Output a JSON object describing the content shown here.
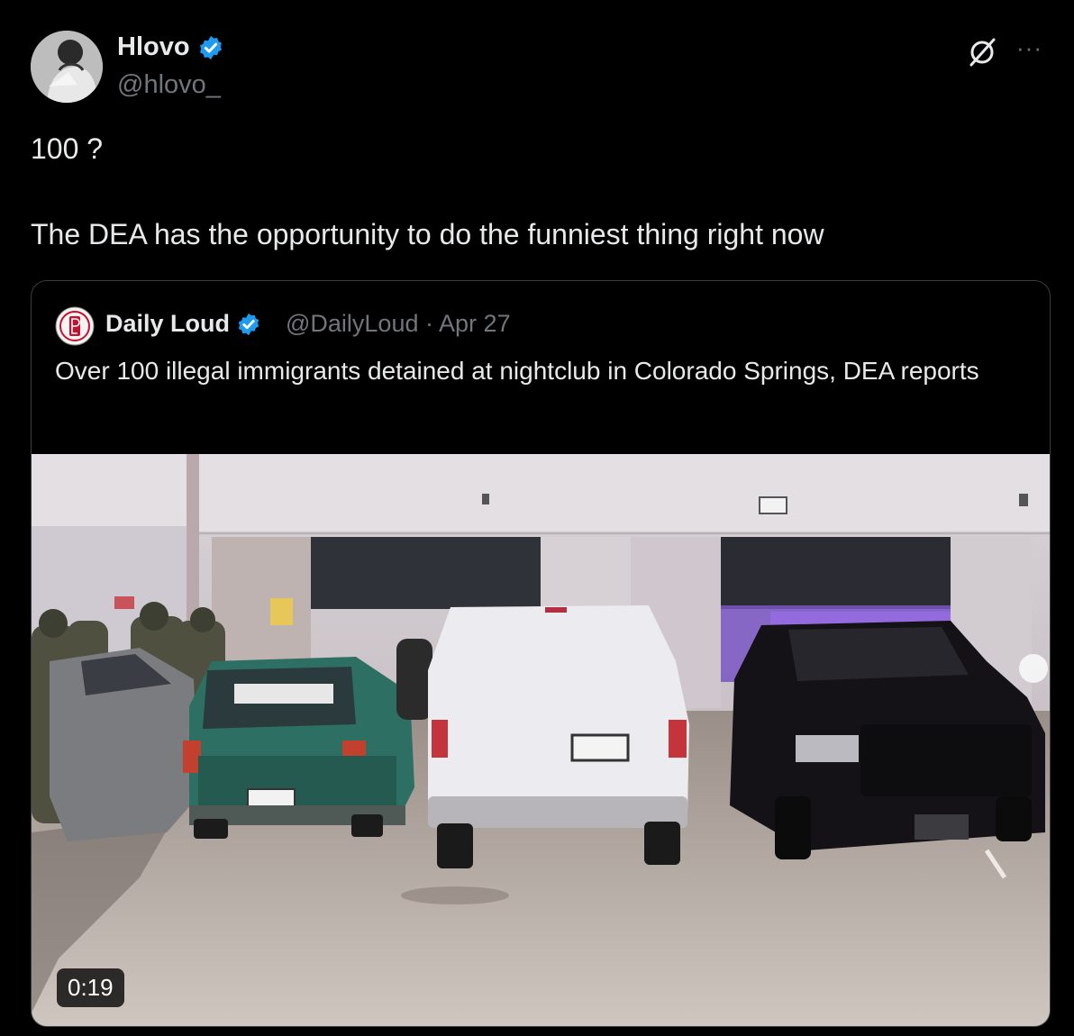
{
  "author": {
    "display_name": "Hlovo",
    "handle": "@hlovo_",
    "verified": true
  },
  "tweet": {
    "lines": [
      "100 ?",
      "The DEA has the opportunity to do the funniest thing right now"
    ]
  },
  "icons": {
    "grok": "grok-icon",
    "more": "more-icon",
    "verified": "verified-badge-icon"
  },
  "quote": {
    "display_name": "Daily Loud",
    "handle": "@DailyLoud",
    "separator": "·",
    "date": "Apr 27",
    "text": "Over 100 illegal immigrants detained at nightclub in Colorado Springs, DEA reports",
    "media": {
      "kind": "video",
      "duration": "0:19"
    }
  },
  "colors": {
    "background": "#000000",
    "text": "#e7e9ea",
    "secondary": "#71767b",
    "verified": "#1d9bf0",
    "border": "#3a3d40"
  }
}
